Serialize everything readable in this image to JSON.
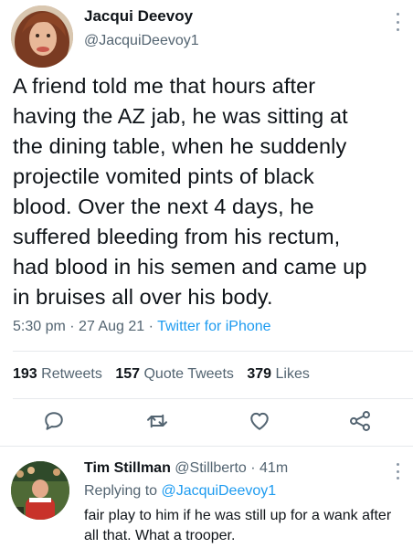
{
  "tweet": {
    "author_name": "Jacqui Deevoy",
    "author_handle": "@JacquiDeevoy1",
    "text": "A friend told me that hours after\nhaving the AZ jab, he was sitting at\nthe dining table, when he suddenly\nprojectile vomited pints of black\nblood. Over the next 4 days, he\nsuffered bleeding from his rectum,\nhad blood in his semen and came up\nin bruises all over his body.",
    "time": "5:30 pm",
    "date": "27 Aug 21",
    "source": "Twitter for iPhone",
    "retweets_count": "193",
    "retweets_label": "Retweets",
    "quotes_count": "157",
    "quotes_label": "Quote Tweets",
    "likes_count": "379",
    "likes_label": "Likes",
    "actions": [
      "reply-icon",
      "retweet-icon",
      "like-icon",
      "share-icon"
    ]
  },
  "reply": {
    "author_name": "Tim Stillman",
    "author_handle": "@Stillberto",
    "age": "41m",
    "replying_prefix": "Replying to",
    "replying_to": "@JacquiDeevoy1",
    "text": "fair play to him if he was still up for a wank after all that. What a trooper."
  },
  "colors": {
    "text": "#0f1419",
    "secondary": "#536471",
    "link": "#1d9bf0",
    "divider": "#e6e9ec"
  }
}
